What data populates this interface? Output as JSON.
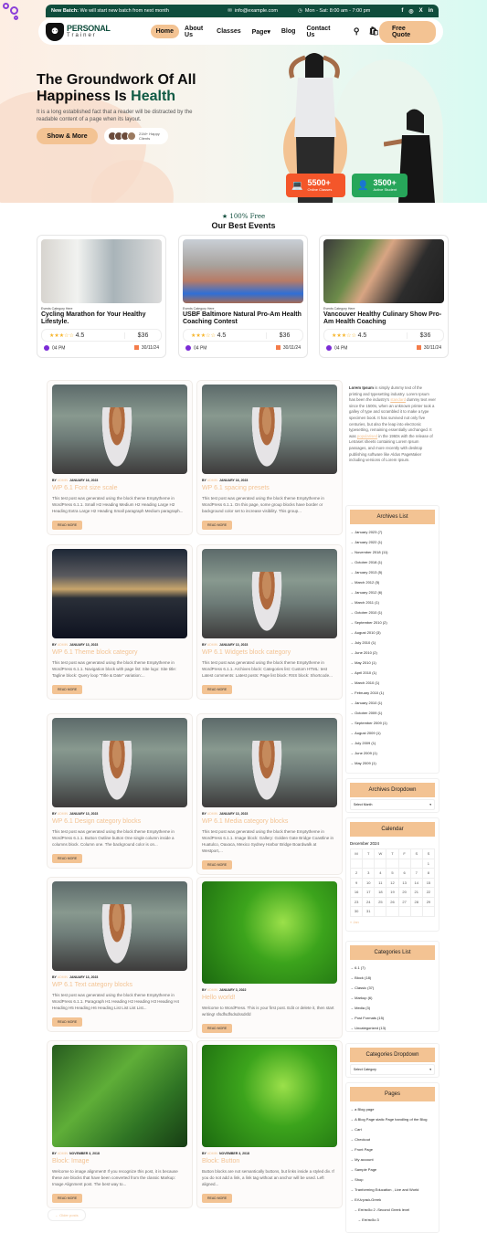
{
  "topbar": {
    "new_batch_label": "New Batch:",
    "new_batch_text": "We will start new batch from next month",
    "email": "info@example.com",
    "hours": "Mon - Sat: 8:00 am - 7:00 pm",
    "social": [
      "f",
      "◎",
      "X",
      "in"
    ]
  },
  "logo": {
    "line1": "PERSONAL",
    "line2": "Trainer"
  },
  "nav": {
    "items": [
      "Home",
      "About Us",
      "Classes",
      "Page",
      "Blog",
      "Contact Us"
    ],
    "active": "Home",
    "page_suffix": "▾",
    "quote": "Free Quote"
  },
  "hero": {
    "title_line1": "The Groundwork Of All",
    "title_line2a": "Happiness Is ",
    "title_line2b": "Health",
    "lead": "It is a long established fact that a reader will be distracted by the readable content of a page when its layout.",
    "show_more": "Show & More",
    "clients_line1": "21M+ Happy",
    "clients_line2": "Clients",
    "stats": [
      {
        "value": "5500+",
        "label": "Online Classes"
      },
      {
        "value": "3500+",
        "label": "Active Student"
      }
    ]
  },
  "events": {
    "tag": "100% Free",
    "title": "Our Best Events",
    "items": [
      {
        "category": "Events Category Here",
        "title": "Cycling Marathon for Your Healthy Lifestyle.",
        "stars": "★★★☆☆",
        "rating": "4.5",
        "price": "$36",
        "time": "04 PM",
        "date": "30/11/24"
      },
      {
        "category": "Events Category Here",
        "title": "USBF Baltimore Natural Pro-Am Health Coaching Contest",
        "stars": "★★★☆☆",
        "rating": "4.5",
        "price": "$36",
        "time": "04 PM",
        "date": "30/11/24"
      },
      {
        "category": "Events Category Here",
        "title": "Vancouver Healthy Culinary Show Pro-Am Health Coaching",
        "stars": "★★★☆☆",
        "rating": "4.5",
        "price": "$36",
        "time": "04 PM",
        "date": "30/11/24"
      }
    ]
  },
  "posts": {
    "by": "BY",
    "author": "ADMIN",
    "read_more": "READ MORE",
    "items": [
      {
        "date": "JANUARY 16, 2023",
        "title": "WP 6.1 Font size scale",
        "excerpt": "This test post was generated using the block theme Emptytheme in WordPress 6.1.1. Small H2 Heading Medium H2 Heading Large H2 Heading Extra Large H2 Heading Small paragraph Medium paragraph..."
      },
      {
        "date": "JANUARY 16, 2023",
        "title": "WP 6.1 spacing presets",
        "excerpt": "This test post was generated using the block theme Emptytheme in WordPress 6.1.1. On this page, some group blocks have border or background color set to increase visibility. This group..."
      },
      {
        "date": "JANUARY 13, 2023",
        "title": "WP 6.1 Theme block category",
        "excerpt": "This test post was generated using the block theme Emptytheme in WordPress 6.1.1. Navigation block with page list: Site logo: Site title: Tagline block: Query loop \"Title & Date\" variation:..."
      },
      {
        "date": "JANUARY 13, 2023",
        "title": "WP 6.1 Widgets block category",
        "excerpt": "This test post was generated using the block theme Emptytheme in WordPress 6.1.1. Archives block: Categories list: Custom HTML: test Latest comments: Latest posts: Page list block: RSS block: Shortcode..."
      },
      {
        "date": "JANUARY 13, 2023",
        "title": "WP 6.1 Design category blocks",
        "excerpt": "This test post was generated using the block theme Emptytheme in WordPress 6.1.1. Button Outline button One single column inside a columns block. Column one. The background color is on..."
      },
      {
        "date": "JANUARY 13, 2023",
        "title": "WP 6.1 Media category blocks",
        "excerpt": "This test post was generated using the block theme Emptytheme in WordPress 6.1.1. Image block: Gallery: Golden Gate Bridge Coastline in Huatulco, Oaxaca, Mexico Sydney Harbor Bridge Boardwalk at Westport,..."
      },
      {
        "date": "JANUARY 13, 2023",
        "title": "WP 6.1 Text category blocks",
        "excerpt": "This test post was generated using the block theme Emptytheme in WordPress 6.1.1. Paragraph H1 Heading H2 Heading H3 Heading H4 Heading H5 Heading H6 Heading List List List List..."
      },
      {
        "date": "JANUARY 3, 2022",
        "title": "Hello world!",
        "excerpt": "Welcome to WordPress. This is your first post. Edit or delete it, then start writing! sfsdfsdfsdsdssdsfd"
      },
      {
        "date": "NOVEMBER 3, 2018",
        "title": "Block: Image",
        "excerpt": "Welcome to image alignment! If you recognize this post, it is because these are blocks that have been converted from the classic Markup: Image Alignment post. The best way to..."
      },
      {
        "date": "NOVEMBER 3, 2018",
        "title": "Block: Button",
        "excerpt": "Button blocks are not semantically buttons, but links inside a styled div.  If you do not add a link, a link tag without an anchor will be used. Left aligned..."
      }
    ],
    "older": "← Older posts"
  },
  "sidebar": {
    "about": {
      "bold": "Lorem Ipsum",
      "text1": " is simply dummy text of the printing and typesetting industry. Lorem Ipsum has been the industry's ",
      "link1": "standard",
      "text2": " dummy text ever since the 1500s, when an unknown printer took a galley of type and scrambled it to make a type specimen book. It has survived not only five centuries, but also the leap into electronic typesetting, remaining essentially unchanged. It was ",
      "link2": "popularised",
      "text3": " in the 1960s with the release of Letraset sheets containing Lorem Ipsum passages, and more recently with desktop publishing software like Aldus PageMaker including versions of Lorem Ipsum."
    },
    "archives": {
      "title": "Archives List",
      "items": [
        "January 2023 (7)",
        "January 2022 (1)",
        "November 2018 (11)",
        "October 2018 (1)",
        "January 2013 (5)",
        "March 2012 (5)",
        "January 2012 (6)",
        "March 2011 (1)",
        "October 2010 (1)",
        "September 2010 (2)",
        "August 2010 (3)",
        "July 2010 (1)",
        "June 2010 (2)",
        "May 2010 (1)",
        "April 2010 (1)",
        "March 2010 (1)",
        "February 2010 (1)",
        "January 2010 (1)",
        "October 2009 (1)",
        "September 2009 (1)",
        "August 2009 (1)",
        "July 2009 (1)",
        "June 2009 (1)",
        "May 2009 (1)"
      ]
    },
    "archives_dropdown": {
      "title": "Archives Dropdown",
      "placeholder": "Select Month"
    },
    "calendar": {
      "title": "Calendar",
      "month": "December 2024",
      "days": [
        "M",
        "T",
        "W",
        "T",
        "F",
        "S",
        "S"
      ],
      "weeks": [
        [
          "",
          "",
          "",
          "",
          "",
          "",
          "1"
        ],
        [
          "2",
          "3",
          "4",
          "5",
          "6",
          "7",
          "8"
        ],
        [
          "9",
          "10",
          "11",
          "12",
          "13",
          "14",
          "15"
        ],
        [
          "16",
          "17",
          "18",
          "19",
          "20",
          "21",
          "22"
        ],
        [
          "23",
          "24",
          "25",
          "26",
          "27",
          "28",
          "29"
        ],
        [
          "30",
          "31",
          "",
          "",
          "",
          "",
          ""
        ]
      ],
      "prev": "« Jan"
    },
    "categories": {
      "title": "Categories List",
      "items": [
        "6.1 (7)",
        "Block (18)",
        "Classic (37)",
        "Markup (6)",
        "Media (3)",
        "Post Formats (15)",
        "Uncategorized (13)"
      ]
    },
    "categories_dropdown": {
      "title": "Categories Dropdown",
      "placeholder": "Select Category"
    },
    "pages": {
      "title": "Pages",
      "items": [
        "a Blog page",
        "A Blog Page static Page handling of the Blog",
        "Cart",
        "Checkout",
        "Front Page",
        "My account",
        "Sample Page",
        "Shop",
        "Tranforming Education , Live and World",
        "ΕΛληνικά-Greek",
        "Επίπεδο 2 -Second Greek level",
        "Επίπεδο 3"
      ]
    }
  }
}
